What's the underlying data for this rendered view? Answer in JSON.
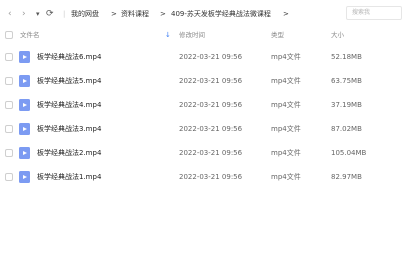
{
  "nav": {
    "back_glyph": "‹",
    "forward_glyph": "›",
    "dropdown_glyph": "▾",
    "refresh_glyph": "⟳"
  },
  "breadcrumb": {
    "items": [
      "我的网盘",
      "资料课程",
      "409-苏天发板学经典战法微课程"
    ],
    "separator": ">"
  },
  "search": {
    "placeholder": "搜索我"
  },
  "columns": {
    "name": "文件名",
    "date": "修改时间",
    "type": "类型",
    "size": "大小"
  },
  "files": [
    {
      "name": "板学经典战法6.mp4",
      "date": "2022-03-21 09:56",
      "type": "mp4文件",
      "size": "52.18MB"
    },
    {
      "name": "板学经典战法5.mp4",
      "date": "2022-03-21 09:56",
      "type": "mp4文件",
      "size": "63.75MB"
    },
    {
      "name": "板学经典战法4.mp4",
      "date": "2022-03-21 09:56",
      "type": "mp4文件",
      "size": "37.19MB"
    },
    {
      "name": "板学经典战法3.mp4",
      "date": "2022-03-21 09:56",
      "type": "mp4文件",
      "size": "87.02MB"
    },
    {
      "name": "板学经典战法2.mp4",
      "date": "2022-03-21 09:56",
      "type": "mp4文件",
      "size": "105.04MB"
    },
    {
      "name": "板学经典战法1.mp4",
      "date": "2022-03-21 09:56",
      "type": "mp4文件",
      "size": "82.97MB"
    }
  ],
  "colors": {
    "file_icon": "#7c9bf2",
    "sort_arrow": "#3b7cf5"
  },
  "icons": {
    "file": "video-file-icon",
    "sort": "sort-down-arrow-icon"
  }
}
